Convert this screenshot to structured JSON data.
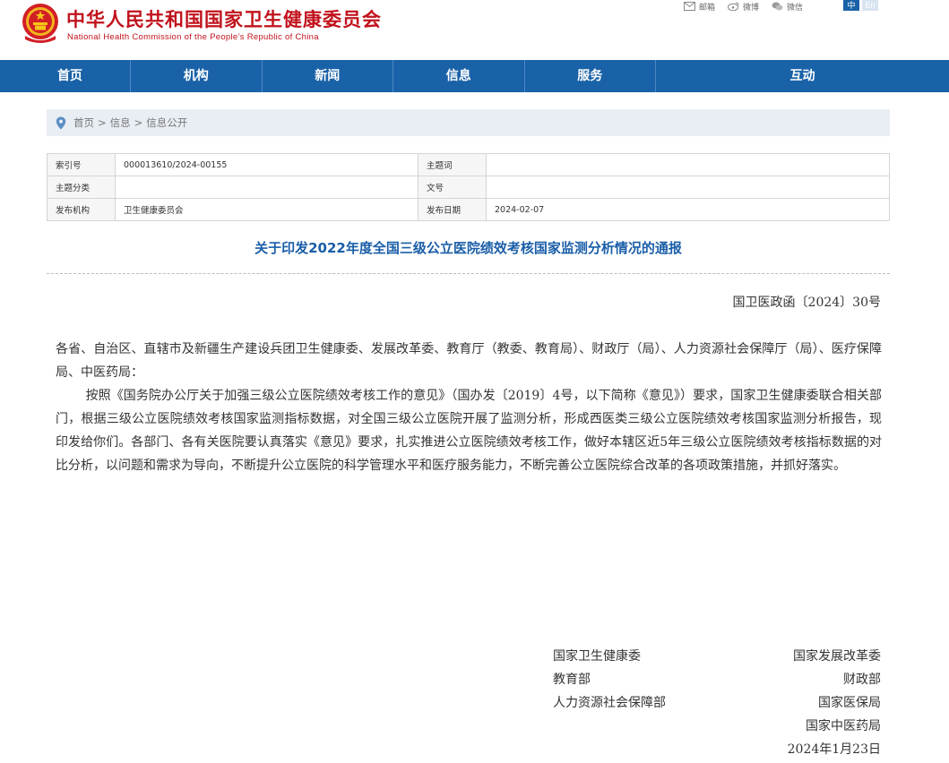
{
  "header": {
    "title_cn": "中华人民共和国国家卫生健康委员会",
    "title_en": "National Health Commission of the People’s Republic of China",
    "links": [
      {
        "label": "邮箱",
        "icon": "mail-icon"
      },
      {
        "label": "微博",
        "icon": "weibo-icon"
      },
      {
        "label": "微信",
        "icon": "wechat-icon"
      }
    ],
    "lang_zh": "中",
    "lang_en": "En"
  },
  "nav": {
    "items": [
      "首页",
      "机构",
      "新闻",
      "信息",
      "服务",
      "互动"
    ]
  },
  "breadcrumb": {
    "items": [
      "首页",
      "信息",
      "信息公开"
    ],
    "separator": ">"
  },
  "info": {
    "index_label": "索引号",
    "index_value": "000013610/2024-00155",
    "keyword_label": "主题词",
    "keyword_value": "",
    "category_label": "主题分类",
    "category_value": "",
    "docnum_label": "文号",
    "docnum_value": "",
    "issuer_label": "发布机构",
    "issuer_value": "卫生健康委员会",
    "date_label": "发布日期",
    "date_value": "2024-02-07"
  },
  "article": {
    "title": "关于印发2022年度全国三级公立医院绩效考核国家监测分析情况的通报",
    "doc_number": "国卫医政函〔2024〕30号",
    "salutation": "各省、自治区、直辖市及新疆生产建设兵团卫生健康委、发展改革委、教育厅（教委、教育局）、财政厅（局）、人力资源社会保障厅（局）、医疗保障局、中医药局：",
    "paragraph": "按照《国务院办公厅关于加强三级公立医院绩效考核工作的意见》（国办发〔2019〕4号，以下简称《意见》）要求，国家卫生健康委联合相关部门，根据三级公立医院绩效考核国家监测指标数据，对全国三级公立医院开展了监测分析，形成西医类三级公立医院绩效考核国家监测分析报告，现印发给你们。各部门、各有关医院要认真落实《意见》要求，扎实推进公立医院绩效考核工作，做好本辖区近5年三级公立医院绩效考核指标数据的对比分析，以问题和需求为导向，不断提升公立医院的科学管理水平和医疗服务能力，不断完善公立医院综合改革的各项政策措施，并抓好落实。",
    "signatures": {
      "left": [
        "国家卫生健康委",
        "教育部",
        "人力资源社会保障部"
      ],
      "right": [
        "国家发展改革委",
        "财政部",
        "国家医保局",
        "国家中医药局"
      ]
    },
    "date": "2024年1月23日"
  },
  "colors": {
    "brand_red": "#c1121c",
    "nav_blue": "#1a62a8",
    "title_blue": "#1a5ea8"
  }
}
